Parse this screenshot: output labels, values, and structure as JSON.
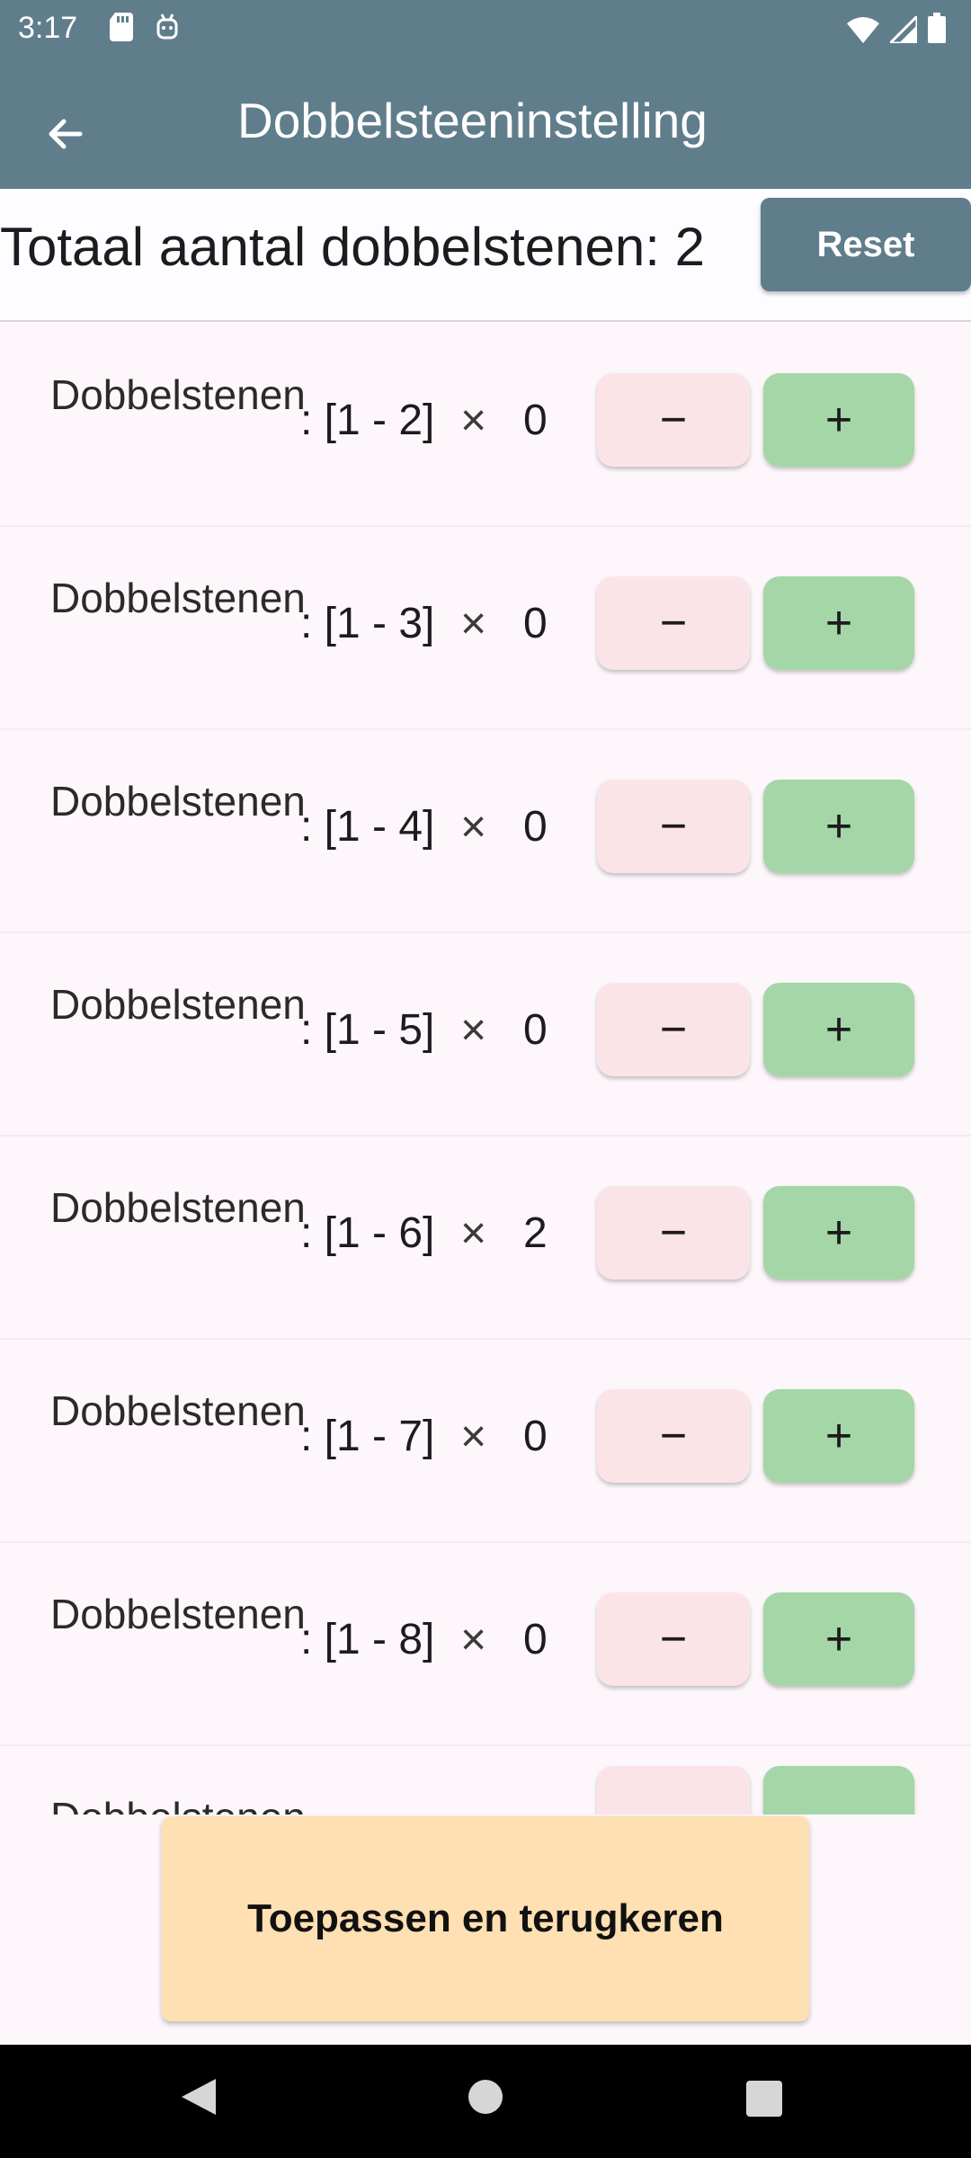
{
  "status": {
    "time": "3:17",
    "left_icons": [
      "sd-card-icon",
      "usb-debug-icon"
    ],
    "right_icons": [
      "wifi-icon",
      "signal-icon",
      "battery-icon"
    ]
  },
  "app_bar": {
    "title": "Dobbelsteeninstelling",
    "back_icon": "arrow-back-icon"
  },
  "header": {
    "total_label": "Totaal aantal dobbelstenen: 2",
    "reset_label": "Reset"
  },
  "dice_rows": [
    {
      "name": "Dobbelstenen",
      "range": ": [1 - 2]",
      "times": "×",
      "count": "0",
      "minus": "−",
      "plus": "+"
    },
    {
      "name": "Dobbelstenen",
      "range": ": [1 - 3]",
      "times": "×",
      "count": "0",
      "minus": "−",
      "plus": "+"
    },
    {
      "name": "Dobbelstenen",
      "range": ": [1 - 4]",
      "times": "×",
      "count": "0",
      "minus": "−",
      "plus": "+"
    },
    {
      "name": "Dobbelstenen",
      "range": ": [1 - 5]",
      "times": "×",
      "count": "0",
      "minus": "−",
      "plus": "+"
    },
    {
      "name": "Dobbelstenen",
      "range": ": [1 - 6]",
      "times": "×",
      "count": "2",
      "minus": "−",
      "plus": "+"
    },
    {
      "name": "Dobbelstenen",
      "range": ": [1 - 7]",
      "times": "×",
      "count": "0",
      "minus": "−",
      "plus": "+"
    },
    {
      "name": "Dobbelstenen",
      "range": ": [1 - 8]",
      "times": "×",
      "count": "0",
      "minus": "−",
      "plus": "+"
    },
    {
      "name": "Dobbelstenen",
      "range": "",
      "times": "",
      "count": "",
      "minus": "",
      "plus": ""
    }
  ],
  "apply_button": "Toepassen en terugkeren",
  "colors": {
    "primary": "#607d8b",
    "minus_button": "#fbe4e8",
    "plus_button": "#a5d6a7",
    "apply_button": "#ffe0b2",
    "background": "#fdf7fb"
  },
  "nav": {
    "back_icon": "nav-back-icon",
    "home_icon": "nav-home-icon",
    "recents_icon": "nav-recents-icon"
  }
}
